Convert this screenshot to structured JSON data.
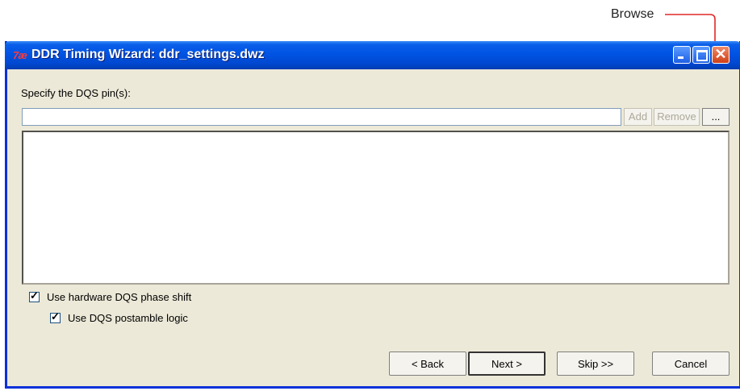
{
  "annotation": {
    "label": "Browse"
  },
  "window": {
    "title": "DDR Timing Wizard: ddr_settings.dwz",
    "icon_text": "7æ"
  },
  "form": {
    "specify_label": "Specify the DQS pin(s):",
    "pin_input_value": "",
    "add_label": "Add",
    "remove_label": "Remove",
    "browse_label": "...",
    "use_hw_phase_shift_label": "Use hardware DQS phase shift",
    "use_hw_phase_shift_checked": true,
    "use_postamble_label": "Use DQS postamble logic",
    "use_postamble_checked": true
  },
  "buttons": {
    "back": "< Back",
    "next": "Next >",
    "skip": "Skip >>",
    "cancel": "Cancel"
  },
  "colors": {
    "annotation": "#e0282a",
    "titlebar": "#0054e3"
  }
}
